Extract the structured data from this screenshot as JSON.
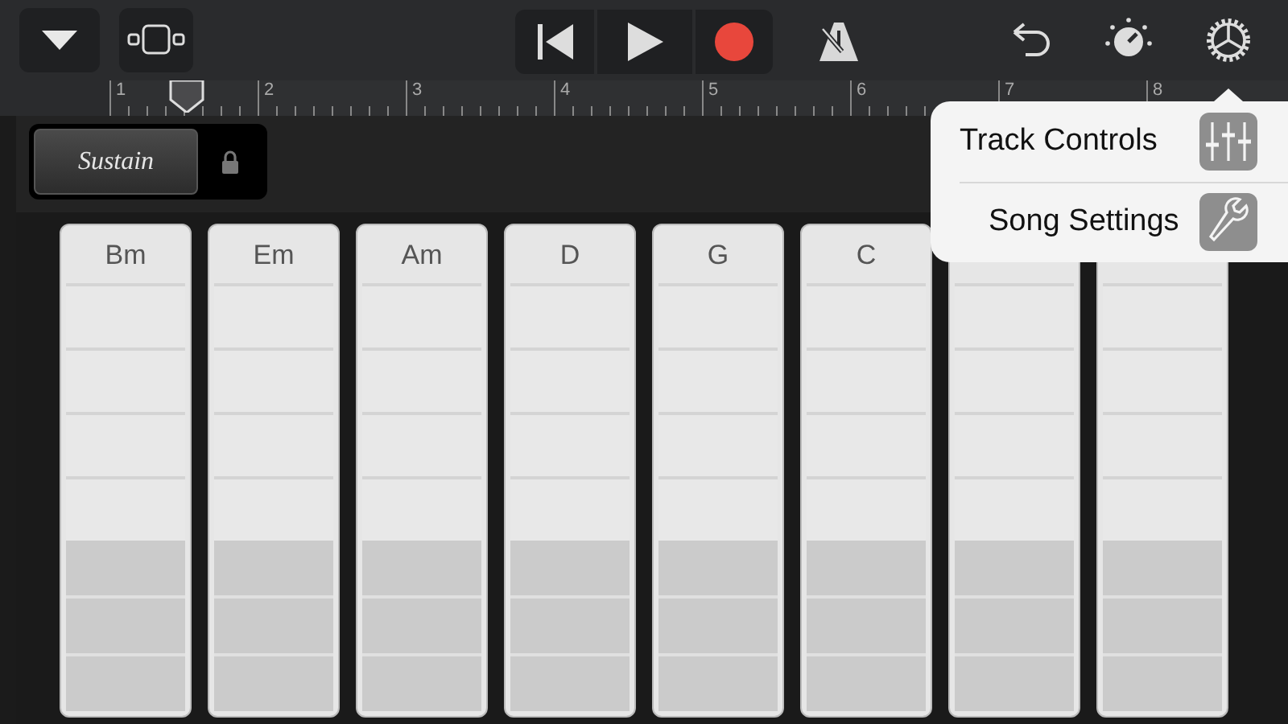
{
  "ruler": {
    "bars": [
      "1",
      "2",
      "3",
      "4",
      "5",
      "6",
      "7",
      "8"
    ]
  },
  "sustain": {
    "label": "Sustain"
  },
  "chords": [
    {
      "kind": "pad",
      "label": "Bm"
    },
    {
      "kind": "pad",
      "label": "Em"
    },
    {
      "kind": "pad",
      "label": "Am"
    },
    {
      "kind": "pad",
      "label": "D"
    },
    {
      "kind": "pad",
      "label": "G"
    },
    {
      "kind": "pad",
      "label": "C"
    },
    {
      "kind": "pad"
    },
    {
      "kind": "pad"
    }
  ],
  "menu": [
    {
      "label": "Track Controls",
      "kind": "sliders"
    },
    {
      "label": "Song Settings",
      "kind": "wrench"
    }
  ]
}
